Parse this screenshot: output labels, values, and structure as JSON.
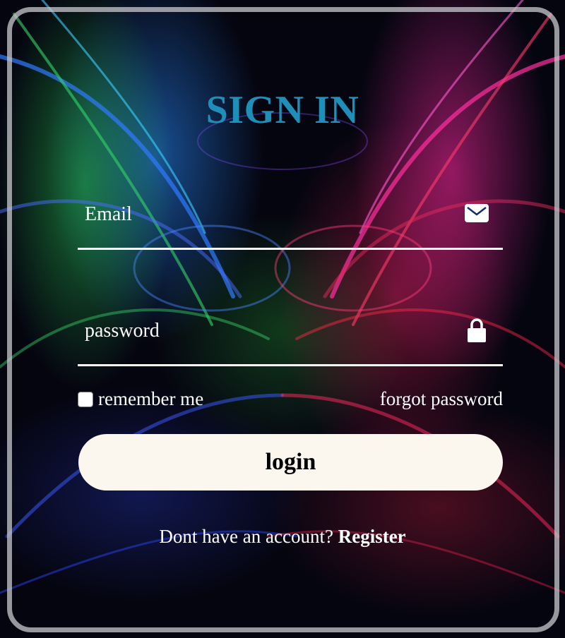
{
  "title": "SIGN IN",
  "email": {
    "placeholder": "Email",
    "icon": "mail-icon"
  },
  "password": {
    "placeholder": "password",
    "icon": "lock-icon"
  },
  "remember": {
    "label": "remember me",
    "checked": false
  },
  "forgot_label": "forgot password",
  "login_label": "login",
  "register": {
    "prompt": "Dont have an account?",
    "link_label": "Register"
  },
  "colors": {
    "title": "#1e8fb8",
    "button_bg": "#fbf7ef",
    "text": "#ffffff"
  }
}
